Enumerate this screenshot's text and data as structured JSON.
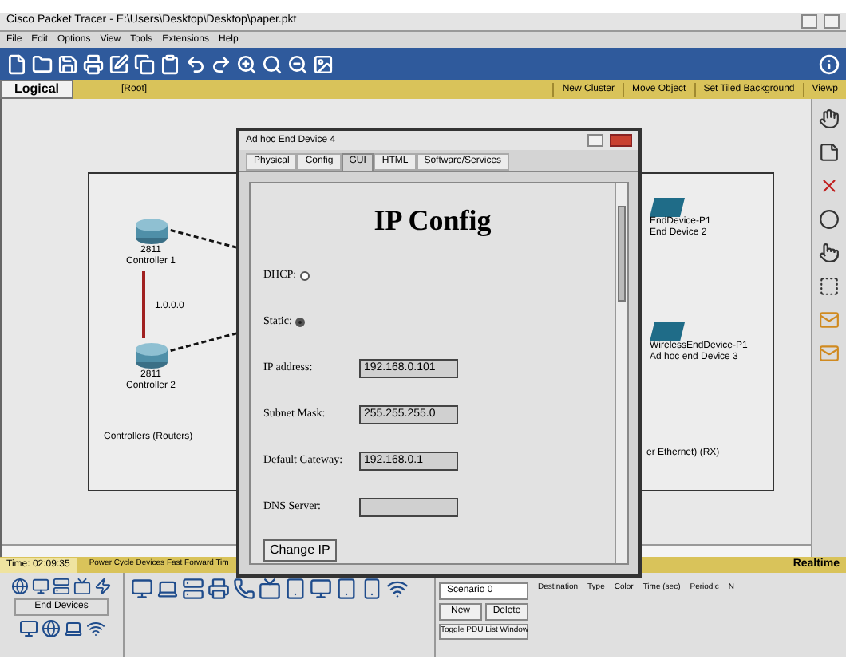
{
  "window": {
    "title": "Cisco Packet Tracer - E:\\Users\\Desktop\\Desktop\\paper.pkt"
  },
  "menu": [
    "File",
    "Edit",
    "Options",
    "View",
    "Tools",
    "Extensions",
    "Help"
  ],
  "workspace_bar": {
    "tab": "Logical",
    "path": "[Root]",
    "actions": [
      "New Cluster",
      "Move Object",
      "Set Tiled Background",
      "Viewp"
    ]
  },
  "canvas": {
    "cluster_label": "Controllers (Routers)",
    "link_label": "1.0.0.0",
    "devices": [
      {
        "kind": "router",
        "model": "2811",
        "name": "Controller 1"
      },
      {
        "kind": "router",
        "model": "2811",
        "name": "Controller 2"
      },
      {
        "kind": "pc",
        "model": "EndDevice-P1",
        "name": "End Device 2"
      },
      {
        "kind": "pc",
        "model": "WirelessEndDevice-P1",
        "name": "Ad hoc end Device 3"
      }
    ],
    "fragment": "er Ethernet) (RX)"
  },
  "dialog": {
    "title": "Ad hoc End Device 4",
    "tabs": [
      {
        "label": "Physical",
        "selected": false
      },
      {
        "label": "Config",
        "selected": false
      },
      {
        "label": "GUI",
        "selected": true
      },
      {
        "label": "HTML",
        "selected": false
      },
      {
        "label": "Software/Services",
        "selected": false
      }
    ],
    "heading": "IP Config",
    "fields": [
      {
        "kind": "radio",
        "label": "DHCP:",
        "selected": false
      },
      {
        "kind": "radio",
        "label": "Static:",
        "selected": true
      },
      {
        "kind": "input",
        "label": "IP address:",
        "value": "192.168.0.101"
      },
      {
        "kind": "input",
        "label": "Subnet Mask:",
        "value": "255.255.255.0"
      },
      {
        "kind": "input",
        "label": "Default Gateway:",
        "value": "192.168.0.1"
      },
      {
        "kind": "input",
        "label": "DNS Server:"
      }
    ],
    "button": "Change IP"
  },
  "status_bar": {
    "time": "Time: 02:09:35",
    "actions": "Power Cycle Devices  Fast Forward Tim",
    "mode": "Realtime"
  },
  "palette": {
    "category": "End Devices"
  },
  "scenario": {
    "name": "Scenario 0",
    "buttons": [
      "New",
      "Delete"
    ],
    "toggle": "Toggle PDU List Window"
  },
  "pdu_columns": [
    "Destination",
    "Type",
    "Color",
    "Time (sec)",
    "Periodic",
    "N"
  ]
}
